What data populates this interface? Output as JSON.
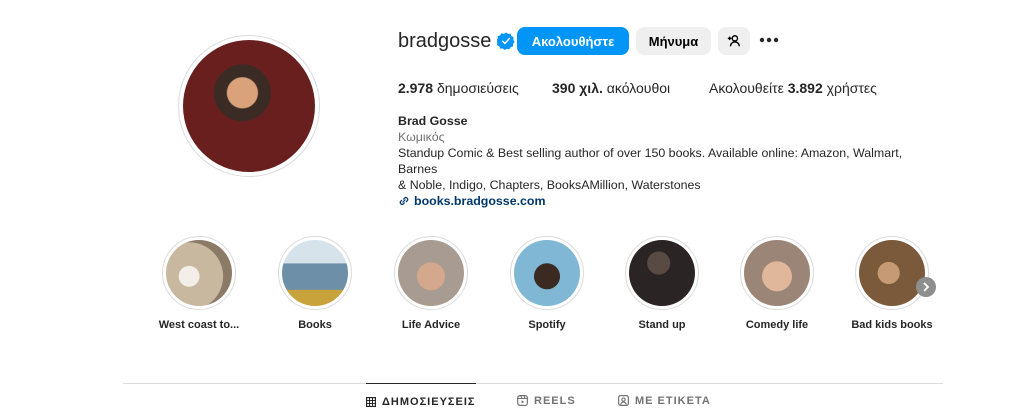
{
  "profile": {
    "username": "bradgosse",
    "follow_label": "Ακολουθήστε",
    "message_label": "Μήνυμα"
  },
  "stats": {
    "posts_count": "2.978",
    "posts_label": "δημοσιεύσεις",
    "followers_count": "390 χιλ.",
    "followers_label": "ακόλουθοι",
    "following_prefix": "Ακολουθείτε",
    "following_count": "3.892",
    "following_suffix": "χρήστες"
  },
  "bio": {
    "name": "Brad Gosse",
    "category": "Κωμικός",
    "text_line1": "Standup Comic & Best selling author of over 150 books. Available online: Amazon, Walmart, Barnes",
    "text_line2": "& Noble, Indigo, Chapters, BooksAMillion, Waterstones",
    "link": "books.bradgosse.com"
  },
  "highlights": [
    {
      "label": "West coast to...",
      "color": "#c9b8a0"
    },
    {
      "label": "Books",
      "color": "#6e8fa8"
    },
    {
      "label": "Life Advice",
      "color": "#a89c92"
    },
    {
      "label": "Spotify",
      "color": "#7fb7d4"
    },
    {
      "label": "Stand up",
      "color": "#2a2424"
    },
    {
      "label": "Comedy life",
      "color": "#9b8577"
    },
    {
      "label": "Bad kids books",
      "color": "#7a5a3a"
    }
  ],
  "tabs": [
    {
      "label": "ΔΗΜΟΣΙΕΥΣΕΙΣ",
      "icon": "grid-icon"
    },
    {
      "label": "REELS",
      "icon": "reels-icon"
    },
    {
      "label": "ΜΕ ΕΤΙΚΕΤΑ",
      "icon": "tagged-icon"
    }
  ],
  "colors": {
    "primary": "#0095f6",
    "verified": "#0095f6",
    "link": "#00376b"
  }
}
